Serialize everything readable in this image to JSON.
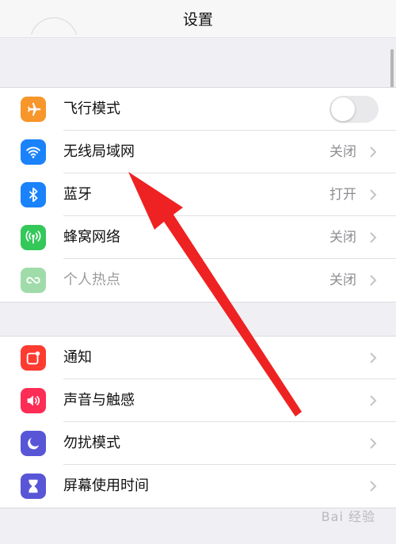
{
  "header": {
    "title": "设置"
  },
  "colors": {
    "airplane": "#f7962b",
    "wifi": "#1a82fb",
    "bluetooth": "#1a82fb",
    "cellular": "#34c759",
    "hotspot": "#9fdcaa",
    "notifications": "#fe3b30",
    "sounds": "#fe2d55",
    "dnd": "#5856d6",
    "screentime": "#5856d6",
    "annotation": "#ee2222"
  },
  "groups": [
    {
      "items": [
        {
          "label": "飞行模式",
          "icon": "airplane-icon",
          "control": "toggle",
          "toggle_on": false
        },
        {
          "label": "无线局域网",
          "icon": "wifi-icon",
          "value": "关闭"
        },
        {
          "label": "蓝牙",
          "icon": "bluetooth-icon",
          "value": "打开"
        },
        {
          "label": "蜂窝网络",
          "icon": "cellular-icon",
          "value": "关闭"
        },
        {
          "label": "个人热点",
          "icon": "hotspot-icon",
          "value": "关闭",
          "disabled": true
        }
      ]
    },
    {
      "items": [
        {
          "label": "通知",
          "icon": "notifications-icon"
        },
        {
          "label": "声音与触感",
          "icon": "sounds-icon"
        },
        {
          "label": "勿扰模式",
          "icon": "moon-icon"
        },
        {
          "label": "屏幕使用时间",
          "icon": "hourglass-icon"
        }
      ]
    }
  ],
  "watermark": {
    "text": "Bai 经验"
  }
}
